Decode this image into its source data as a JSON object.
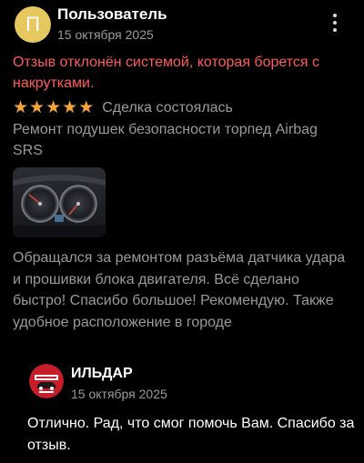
{
  "review": {
    "author": {
      "initial": "П",
      "name": "Пользователь",
      "date": "15 октября 2025",
      "avatar_color": "#e6c85f"
    },
    "menu_icon": "more-vertical-icon",
    "moderation_notice": "Отзыв отклонён системой, которая борется с накрутками.",
    "notice_color": "#ff5b5b",
    "rating": {
      "value": 5,
      "max": 5,
      "star_color": "#f2a33a"
    },
    "deal_status": "Сделка состоялась",
    "service": "Ремонт подушек безопасности торпед Airbag SRS",
    "text": "Обращался за ремонтом разъёма датчика удара и прошивки блока двигателя. Всё сделано быстро! Спасибо большое! Рекомендую. Также удобное расположение в городе"
  },
  "reply": {
    "name": "ИЛЬДАР",
    "date": "15 октября 2025",
    "text": "Отлично. Рад, что смог помочь Вам. Спасибо за отзыв."
  }
}
